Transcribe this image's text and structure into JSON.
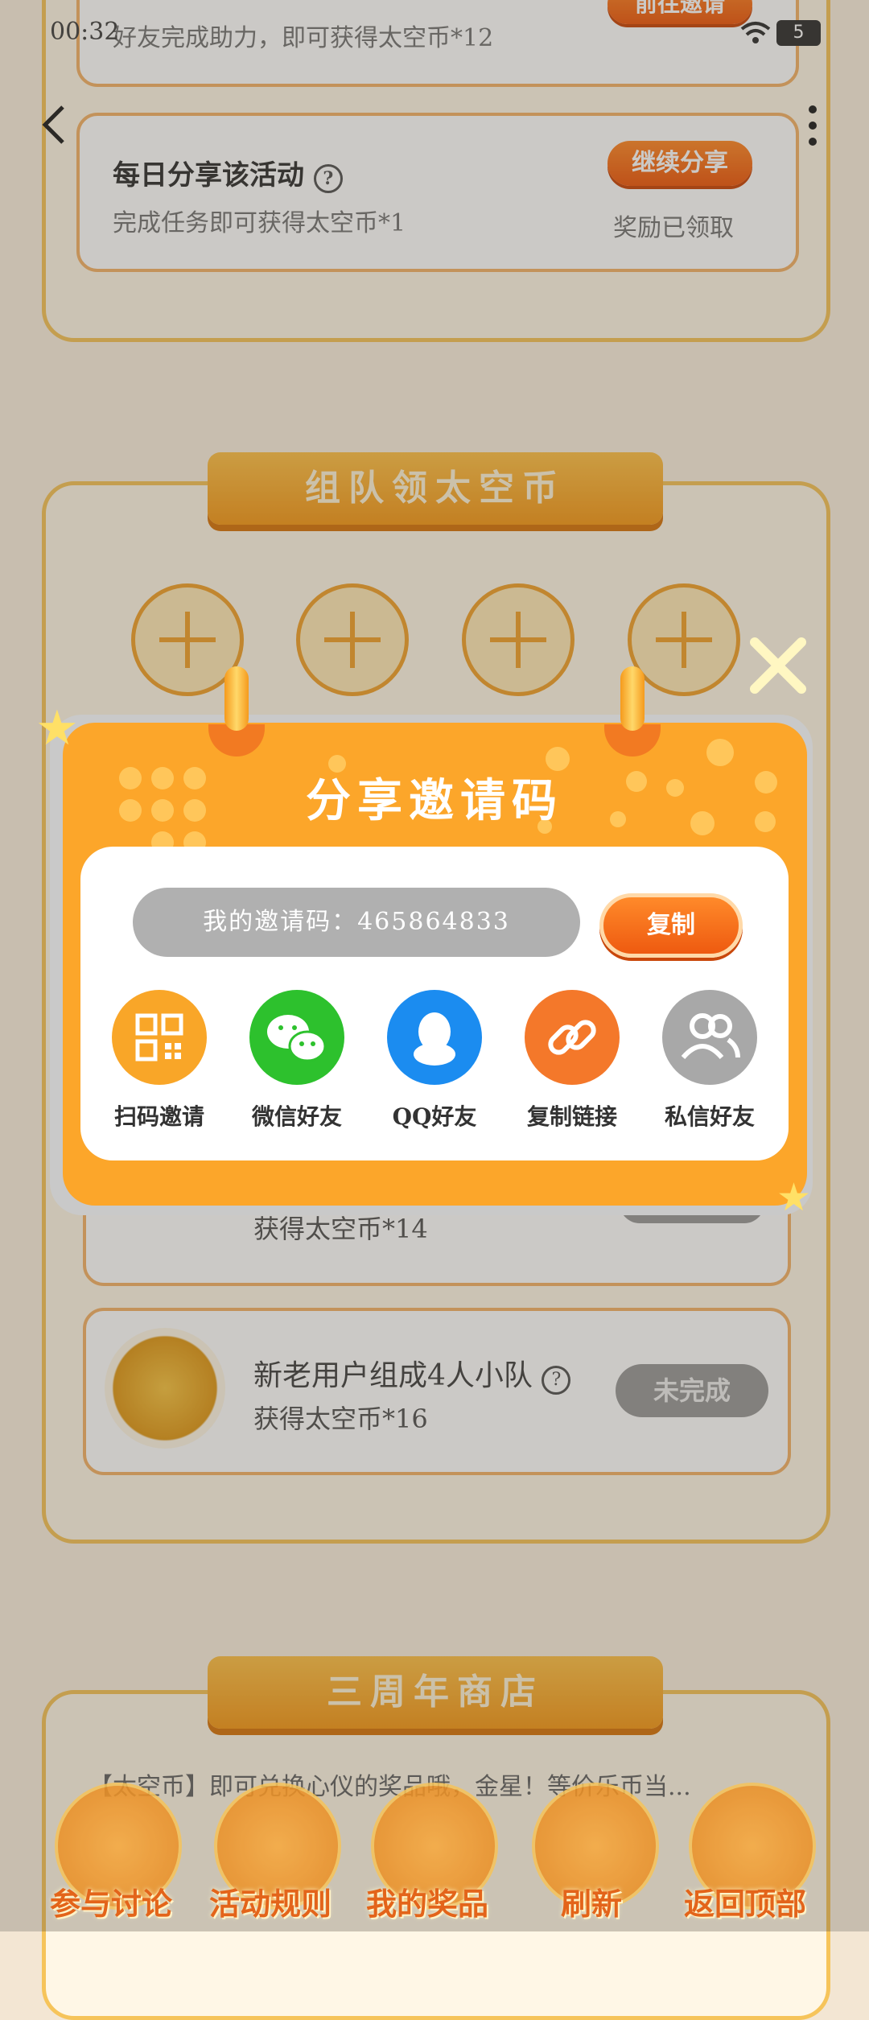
{
  "status_bar": {
    "time": "00:32",
    "battery": "5"
  },
  "header": {
    "back_icon": "back-arrow-icon",
    "menu_icon": "more-vertical-icon"
  },
  "tasks_top": {
    "partial_desc": "好友完成助力，即可获得太空币*12",
    "partial_button": "前往邀请",
    "share_title": "每日分享该活动",
    "share_desc": "完成任务即可获得太空币*1",
    "share_button": "继续分享",
    "share_status": "奖励已领取"
  },
  "team_section": {
    "title": "组队领太空币",
    "task2_desc": "获得太空币*14",
    "task3_title": "新老用户组成4人小队",
    "task3_desc": "获得太空币*16",
    "task3_button": "未完成"
  },
  "shop_section": {
    "title": "三周年商店",
    "desc": "【太空币】即可兑换心仪的奖品哦，金星！等价乐币当..."
  },
  "modal": {
    "title": "分享邀请码",
    "code_text": "我的邀请码：465864833",
    "copy_button": "复制",
    "close_icon": "close-x-icon",
    "share_options": [
      {
        "label": "扫码邀请",
        "icon": "qr-code-icon",
        "color": "#f9a628"
      },
      {
        "label": "微信好友",
        "icon": "wechat-icon",
        "color": "#2dc12d"
      },
      {
        "label": "QQ好友",
        "icon": "qq-penguin-icon",
        "color": "#1b8cf0"
      },
      {
        "label": "复制链接",
        "icon": "link-icon",
        "color": "#f4782a"
      },
      {
        "label": "私信好友",
        "icon": "friends-icon",
        "color": "#a8a8a8"
      }
    ]
  },
  "bottom_nav": [
    {
      "label": "参与讨论",
      "icon": "chat-icon"
    },
    {
      "label": "活动规则",
      "icon": "star-rules-icon"
    },
    {
      "label": "我的奖品",
      "icon": "gift-icon"
    },
    {
      "label": "刷新",
      "icon": "refresh-icon"
    },
    {
      "label": "返回顶部",
      "icon": "upload-top-icon"
    }
  ]
}
